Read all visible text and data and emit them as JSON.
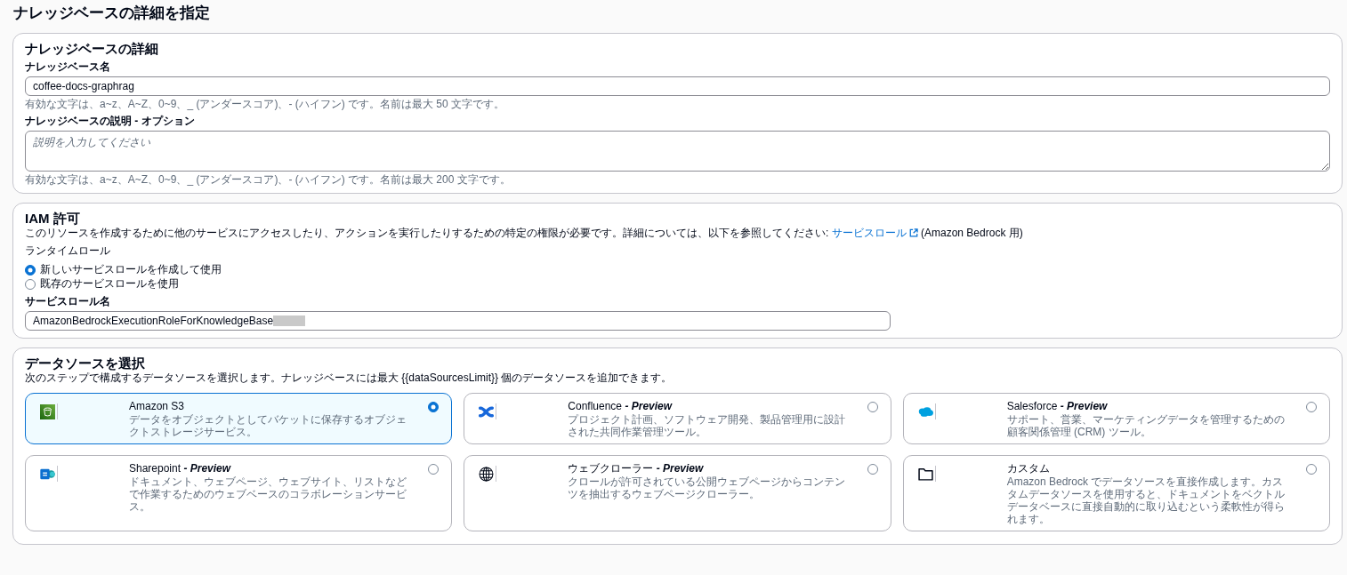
{
  "page": {
    "title": "ナレッジベースの詳細を指定"
  },
  "knowledge_base_details": {
    "heading": "ナレッジベースの詳細",
    "fields": [
      {
        "kind": "input",
        "label": "ナレッジベース名",
        "value": "coffee-docs-graphrag",
        "hint": "有効な文字は、a~z、A~Z、0~9、_ (アンダースコア)、- (ハイフン) です。名前は最大 50 文字です。"
      },
      {
        "kind": "textarea",
        "label": "ナレッジベースの説明 - オプション",
        "placeholder": "説明を入力してください",
        "hint": "有効な文字は、a~z、A~Z、0~9、_ (アンダースコア)、- (ハイフン) です。名前は最大 200 文字です。"
      }
    ]
  },
  "iam_permissions": {
    "heading": "IAM 許可",
    "description": "このリソースを作成するために他のサービスにアクセスしたり、アクションを実行したりするための特定の権限が必要です。詳細については、以下を参照してください:",
    "link": {
      "text": "サービスロール",
      "external": true
    },
    "description_after_link": "(Amazon Bedrock 用)",
    "runtime_role_label": "ランタイムロール",
    "runtime_role_options": [
      {
        "label": "新しいサービスロールを作成して使用",
        "selected": true
      },
      {
        "label": "既存のサービスロールを使用",
        "selected": false
      }
    ],
    "service_role_name": {
      "label": "サービスロール名",
      "value": "AmazonBedrockExecutionRoleForKnowledgeBase",
      "redacted": true
    }
  },
  "data_sources": {
    "heading": "データソースを選択",
    "description": "次のステップで構成するデータソースを選択します。ナレッジベースには最大 {{dataSourcesLimit}} 個のデータソースを追加できます。",
    "options": [
      {
        "kind": "s3",
        "name": "Amazon S3",
        "description": "データをオブジェクトとしてバケットに保存するオブジェクトストレージサービス。",
        "selected": true
      },
      {
        "kind": "confluence",
        "name": "Confluence",
        "tag": "- Preview",
        "description": "プロジェクト計画、ソフトウェア開発、製品管理用に設計された共同作業管理ツール。",
        "selected": false
      },
      {
        "kind": "salesforce",
        "name": "Salesforce",
        "tag": "- Preview",
        "description": "サポート、営業、マーケティングデータを管理するための顧客関係管理 (CRM) ツール。",
        "selected": false
      },
      {
        "kind": "sharepoint",
        "name": "Sharepoint",
        "tag": "- Preview",
        "description": "ドキュメント、ウェブページ、ウェブサイト、リストなどで作業するためのウェブベースのコラボレーションサービス。",
        "selected": false
      },
      {
        "kind": "web",
        "name": "ウェブクローラー",
        "tag": "- Preview",
        "description": "クロールが許可されている公開ウェブページからコンテンツを抽出するウェブページクローラー。",
        "selected": false
      },
      {
        "kind": "custom",
        "name": "カスタム",
        "description": "Amazon Bedrock でデータソースを直接作成します。カスタムデータソースを使用すると、ドキュメントをベクトルデータベースに直接自動的に取り込むという柔軟性が得られます。",
        "selected": false
      }
    ]
  }
}
